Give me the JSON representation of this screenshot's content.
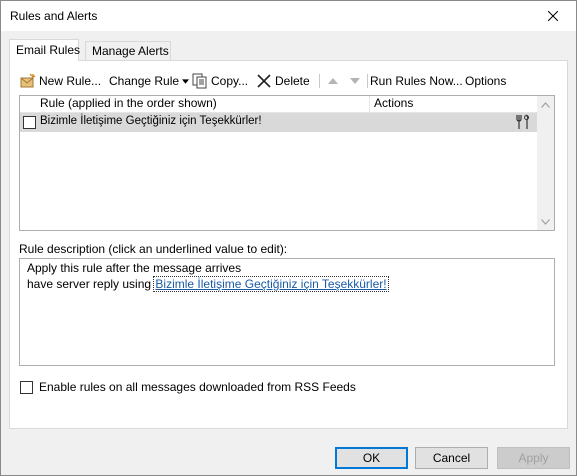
{
  "window": {
    "title": "Rules and Alerts"
  },
  "tabs": [
    {
      "label": "Email Rules",
      "active": true
    },
    {
      "label": "Manage Alerts",
      "active": false
    }
  ],
  "toolbar": {
    "new_rule": "New Rule...",
    "change_rule": "Change Rule",
    "copy": "Copy...",
    "delete": "Delete",
    "run_rules_now": "Run Rules Now...",
    "options": "Options"
  },
  "rules_list": {
    "columns": [
      "Rule (applied in the order shown)",
      "Actions"
    ],
    "rows": [
      {
        "name": "Bizimle İletişime Geçtiğiniz için Teşekkürler!",
        "enabled": false,
        "selected": true,
        "action_icon": "server-reply-icon"
      }
    ]
  },
  "description": {
    "label": "Rule description (click an underlined value to edit):",
    "line1": "Apply this rule after the message arrives",
    "line2_prefix": "have server reply using ",
    "line2_link": "Bizimle İletişime Geçtiğiniz için Teşekkürler!"
  },
  "rss": {
    "label": "Enable rules on all messages downloaded from RSS Feeds",
    "checked": false
  },
  "buttons": {
    "ok": "OK",
    "cancel": "Cancel",
    "apply": "Apply"
  },
  "colors": {
    "accent": "#0078d7",
    "selection": "#d9d9d9",
    "link": "#1a5aa8"
  }
}
